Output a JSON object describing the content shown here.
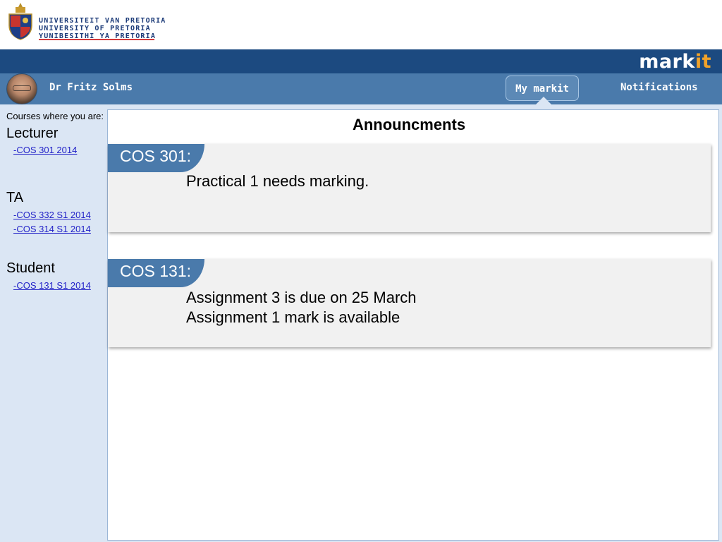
{
  "university": {
    "names": [
      "UNIVERSITEIT VAN PRETORIA",
      "UNIVERSITY OF PRETORIA",
      "YUNIBESITHI YA PRETORIA"
    ]
  },
  "app": {
    "brand_main": "mark",
    "brand_accent": "it"
  },
  "nav": {
    "user_name": "Dr Fritz Solms",
    "my_markit": "My markit",
    "notifications": "Notifications"
  },
  "sidebar": {
    "heading": "Courses where you are:",
    "roles": [
      {
        "label": "Lecturer",
        "courses": [
          "-COS 301 2014"
        ]
      },
      {
        "label": "TA",
        "courses": [
          "-COS 332 S1 2014",
          "-COS 314 S1 2014"
        ]
      },
      {
        "label": "Student",
        "courses": [
          "-COS 131 S1 2014"
        ]
      }
    ]
  },
  "main": {
    "title": "Announcments",
    "announcements": [
      {
        "course": "COS 301:",
        "lines": [
          "Practical 1 needs marking."
        ]
      },
      {
        "course": "COS 131:",
        "lines": [
          "Assignment 3 is due on 25 March",
          "Assignment 1 mark is available"
        ]
      }
    ]
  },
  "colors": {
    "brand_bar": "#1c4a80",
    "nav_bar": "#4a7aab",
    "sidebar_bg": "#dbe6f4",
    "brand_accent": "#f0a22a",
    "link": "#2323c8"
  }
}
